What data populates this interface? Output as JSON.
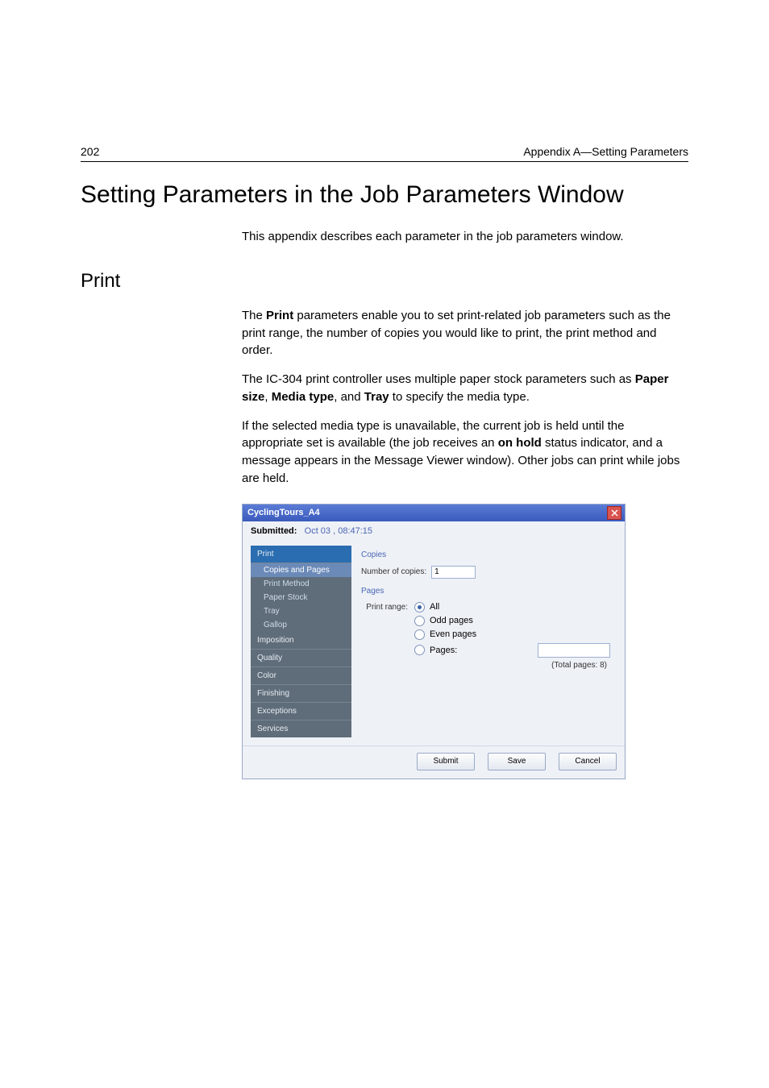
{
  "header": {
    "page_number": "202",
    "right_text": "Appendix A—Setting Parameters"
  },
  "main_heading": "Setting Parameters in the Job Parameters Window",
  "intro": "This appendix describes each parameter in the job parameters window.",
  "section_heading": "Print",
  "para1_pre": "The ",
  "para1_bold1": "Print",
  "para1_post": " parameters enable you to set print-related job parameters such as the print range, the number of copies you would like to print, the print method and order.",
  "para2_pre": "The IC-304 print controller uses multiple paper stock parameters such as ",
  "para2_b1": "Paper size",
  "para2_m1": ", ",
  "para2_b2": "Media type",
  "para2_m2": ", and ",
  "para2_b3": "Tray",
  "para2_post": " to specify the media type.",
  "para3_pre": "If the selected media type is unavailable, the current job is held until the appropriate set is available (the job receives an ",
  "para3_b1": "on hold",
  "para3_post": " status indicator, and a message appears in the Message Viewer window). Other jobs can print while jobs are held.",
  "dialog": {
    "title": "CyclingTours_A4",
    "submitted_label": "Submitted:",
    "submitted_value": "Oct 03 , 08:47:15",
    "sidebar": {
      "head": "Print",
      "subs": [
        "Copies and Pages",
        "Print Method",
        "Paper Stock",
        "Tray",
        "Gallop"
      ],
      "groups": [
        "Imposition",
        "Quality",
        "Color",
        "Finishing",
        "Exceptions",
        "Services"
      ]
    },
    "pane": {
      "copies_head": "Copies",
      "num_copies_label": "Number of copies:",
      "num_copies_value": "1",
      "pages_head": "Pages",
      "print_range_label": "Print range:",
      "range_all": "All",
      "range_odd": "Odd pages",
      "range_even": "Even pages",
      "range_pages": "Pages:",
      "total_pages": "(Total pages: 8)"
    },
    "buttons": {
      "submit": "Submit",
      "save": "Save",
      "cancel": "Cancel"
    }
  }
}
